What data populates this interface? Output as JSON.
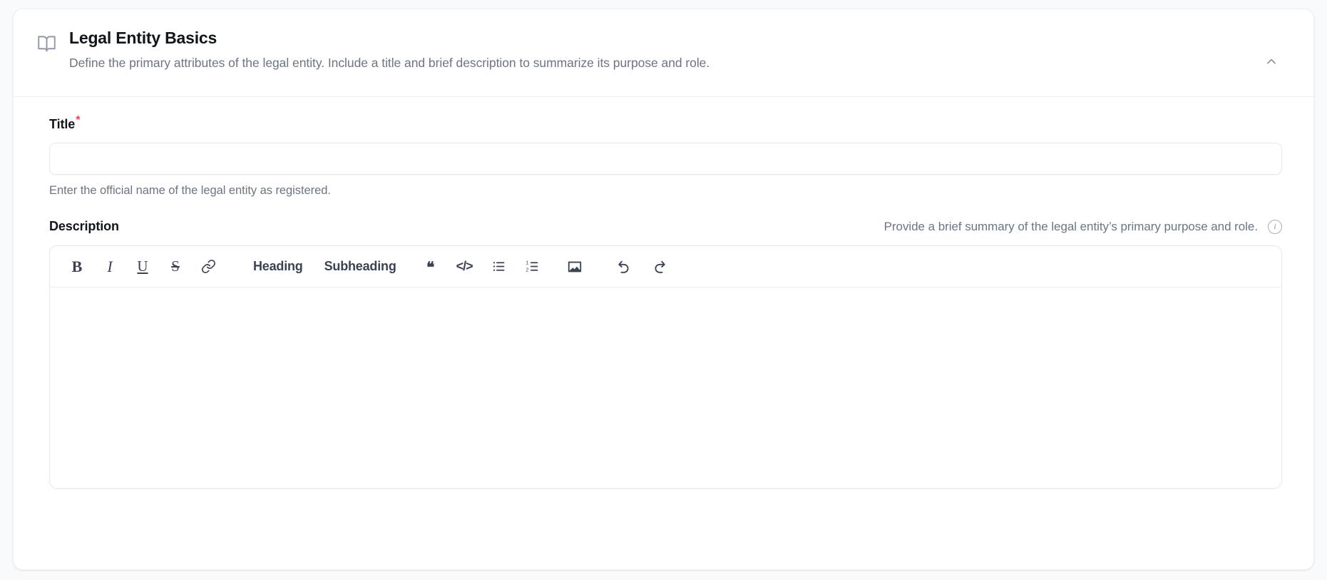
{
  "card": {
    "icon": "book-open-icon",
    "title": "Legal Entity Basics",
    "subtitle": "Define the primary attributes of the legal entity. Include a title and brief description to summarize its purpose and role.",
    "collapse_icon": "chevron-up-icon"
  },
  "title_field": {
    "label": "Title",
    "required_marker": "*",
    "value": "",
    "placeholder": "",
    "helper": "Enter the official name of the legal entity as registered."
  },
  "description_field": {
    "label": "Description",
    "hint": "Provide a brief summary of the legal entity’s primary purpose and role.",
    "info_icon": "info-circle-icon",
    "info_glyph": "i",
    "value": "",
    "placeholder": ""
  },
  "toolbar": {
    "bold": {
      "label": "B",
      "name": "bold-icon"
    },
    "italic": {
      "label": "I",
      "name": "italic-icon"
    },
    "underline": {
      "label": "U",
      "name": "underline-icon"
    },
    "strikethrough": {
      "label": "S",
      "name": "strikethrough-icon"
    },
    "link": {
      "label": "🔗",
      "name": "link-icon"
    },
    "heading": {
      "label": "Heading",
      "name": "heading-button"
    },
    "subheading": {
      "label": "Subheading",
      "name": "subheading-button"
    },
    "quote": {
      "label": "❝",
      "name": "blockquote-icon"
    },
    "code": {
      "label": "</>",
      "name": "code-block-icon"
    },
    "bullet_list": {
      "label": "",
      "name": "bullet-list-icon"
    },
    "numbered_list": {
      "label": "",
      "name": "numbered-list-icon"
    },
    "image": {
      "label": "",
      "name": "image-icon"
    },
    "undo": {
      "label": "",
      "name": "undo-icon"
    },
    "redo": {
      "label": "",
      "name": "redo-icon"
    }
  },
  "colors": {
    "page_bg": "#f8fafc",
    "card_bg": "#ffffff",
    "border": "#e6e8ec",
    "title": "#11151c",
    "muted": "#6b7585",
    "icon": "#3a4356",
    "required": "#f43f5e"
  }
}
